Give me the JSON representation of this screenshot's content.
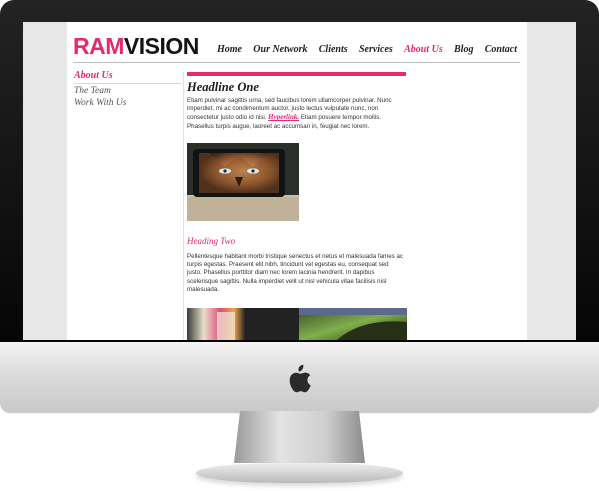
{
  "site": {
    "logo_part1": "RAM",
    "logo_part2": "VISION"
  },
  "nav": {
    "items": [
      {
        "label": "Home",
        "active": false
      },
      {
        "label": "Our Network",
        "active": false
      },
      {
        "label": "Clients",
        "active": false
      },
      {
        "label": "Services",
        "active": false
      },
      {
        "label": "About Us",
        "active": true
      },
      {
        "label": "Blog",
        "active": false
      },
      {
        "label": "Contact",
        "active": false
      }
    ]
  },
  "sidebar": {
    "title": "About Us",
    "items": [
      "The Team",
      "Work With Us"
    ]
  },
  "main": {
    "headline": "Headline One",
    "para1_before": "Etiam pulvinar sagittis urna, sed faucibus lorem ullamcorper pulvinar. Nunc imperdiet, mi ac condimentum auctor, justo lectus vulputate nunc, non consectetur justo odio id nisi. ",
    "hyperlink": "Hyperlink.",
    "para1_after": " Etiam posuere tempor mollis. Phasellus turpis augue, laoreet ac accumsan in, feugiat nec lorem.",
    "heading_two": "Heading Two",
    "para2": "Pellentesque habitant morbi tristique senectus et netus et malesuada fames ac turpis egestas. Praesent elit nibh, tincidunt vel egestas eu, consequat sed justo. Phasellus porttitor diam nec lorem lacinia hendrerit. In dapibus scelerisque sagittis. Nulla imperdiet velit ut nisl vehicula vitae facilisis nisl malesuada."
  },
  "colors": {
    "accent": "#e8286f",
    "text": "#333333"
  },
  "icons": {
    "device_logo": "apple-logo-icon"
  }
}
